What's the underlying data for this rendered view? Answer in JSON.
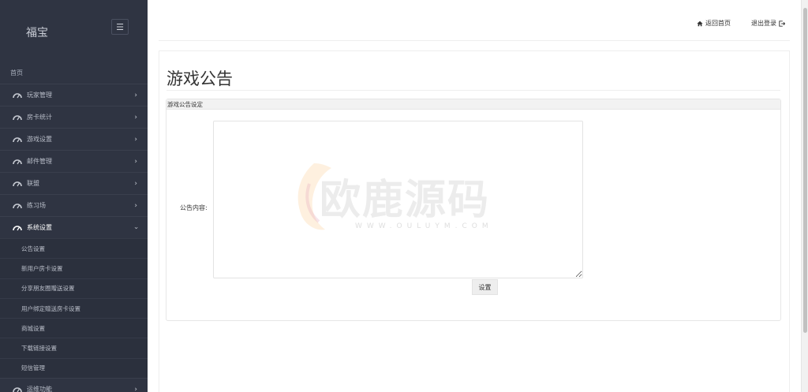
{
  "sidebar": {
    "brand": "福宝",
    "home": "首页",
    "items": [
      {
        "label": "玩家管理"
      },
      {
        "label": "房卡统计"
      },
      {
        "label": "游戏设置"
      },
      {
        "label": "邮件管理"
      },
      {
        "label": "联盟"
      },
      {
        "label": "练习场"
      },
      {
        "label": "系统设置"
      }
    ],
    "sub_items": [
      {
        "label": "公告设置"
      },
      {
        "label": "新用户房卡设置"
      },
      {
        "label": "分享朋友圈赠送设置"
      },
      {
        "label": "用户绑定赠送房卡设置"
      },
      {
        "label": "商城设置"
      },
      {
        "label": "下载链接设置"
      },
      {
        "label": "短信管理"
      }
    ],
    "last_item": {
      "label": "运维功能"
    }
  },
  "header": {
    "home_link": "返回首页",
    "logout_link": "退出登录"
  },
  "main": {
    "title": "游戏公告",
    "panel_title": "游戏公告设定",
    "field_label": "公告内容:",
    "textarea_value": "",
    "save_label": "设置"
  },
  "watermark": {
    "text": "欧鹿源码",
    "sub": "WWW.OULUYM.COM"
  }
}
